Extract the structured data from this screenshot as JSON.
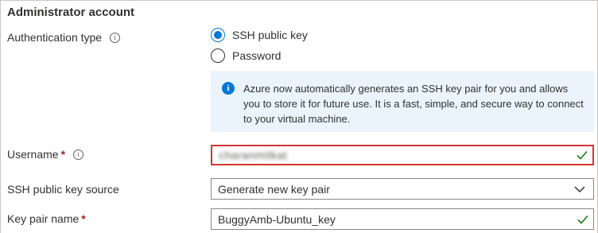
{
  "section": {
    "title": "Administrator account"
  },
  "auth": {
    "label": "Authentication type",
    "info_icon": "info-icon",
    "options": [
      {
        "label": "SSH public key",
        "selected": true
      },
      {
        "label": "Password",
        "selected": false
      }
    ]
  },
  "infobar": {
    "icon": "info-filled-icon",
    "text": "Azure now automatically generates an SSH key pair for you and allows you to store it for future use. It is a fast, simple, and secure way to connect to your virtual machine."
  },
  "username": {
    "label": "Username",
    "required_mark": "*",
    "value": "charanmitkat",
    "valid": true
  },
  "ssh_source": {
    "label": "SSH public key source",
    "selected": "Generate new key pair"
  },
  "key_pair": {
    "label": "Key pair name",
    "required_mark": "*",
    "value": "BuggyAmb-Ubuntu_key",
    "valid": true
  },
  "colors": {
    "accent": "#0078d4",
    "success": "#107c10",
    "required": "#a4262c",
    "highlight": "#d13438",
    "info_background": "#ebf3fc"
  }
}
